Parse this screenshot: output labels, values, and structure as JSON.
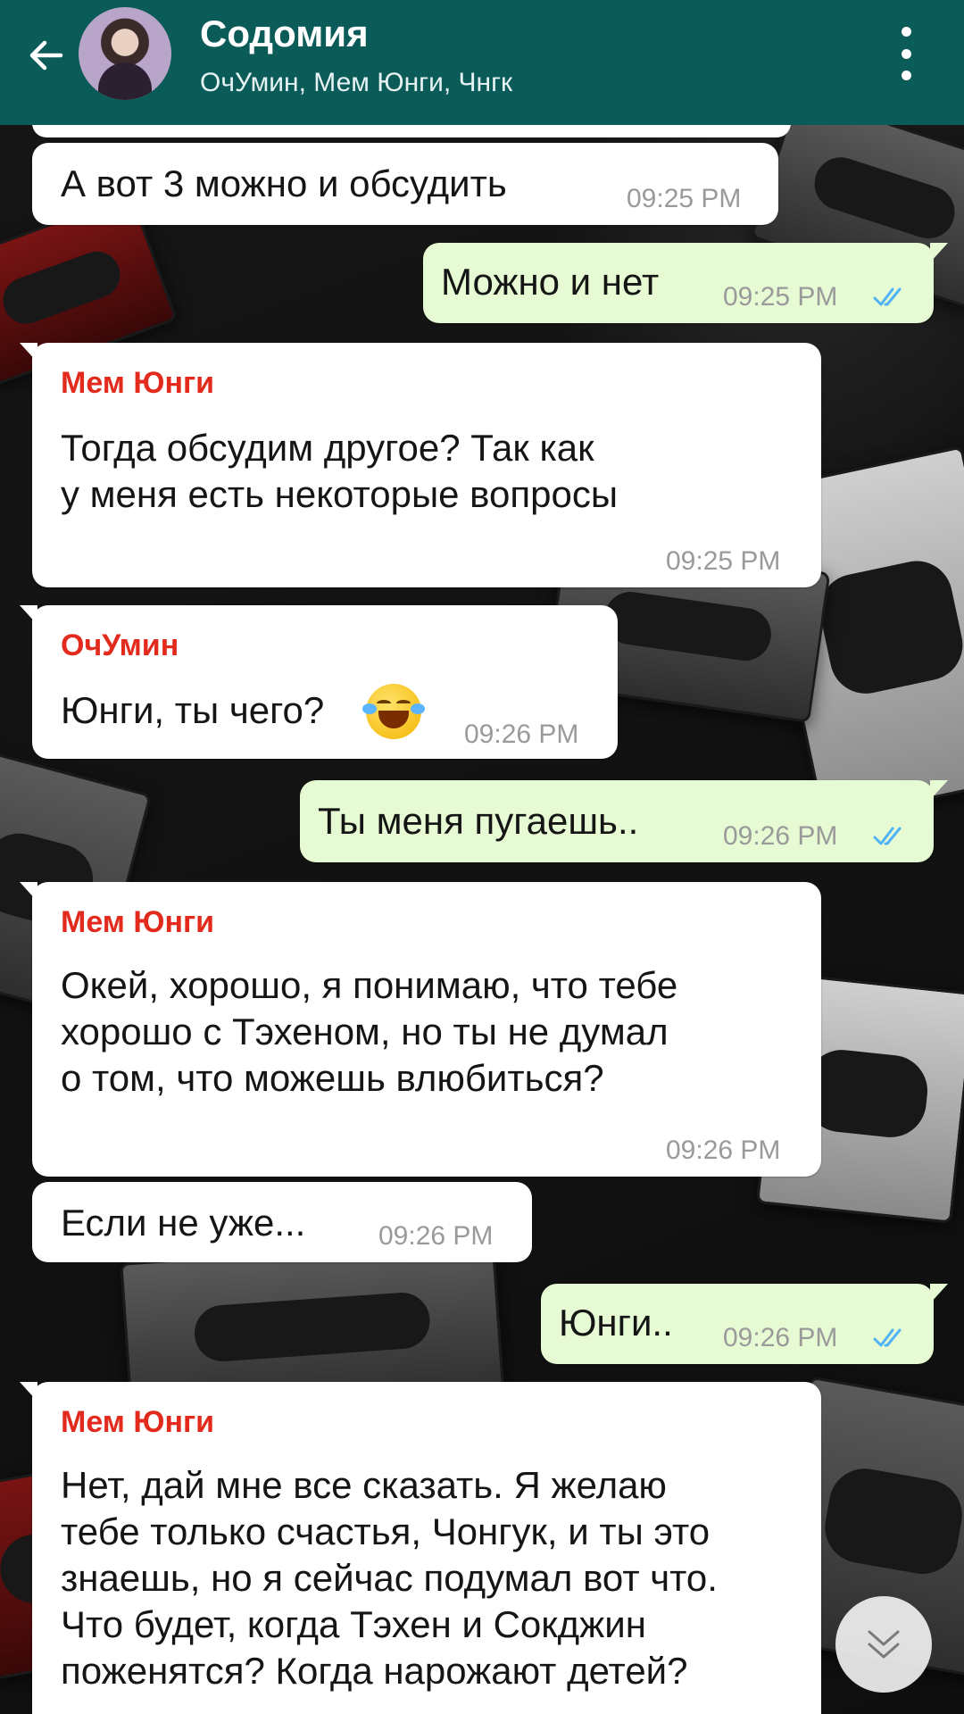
{
  "header": {
    "title": "Содомия",
    "subtitle": "ОчУмин, Мем Юнги, Чнгк",
    "back_icon": "arrow-left-icon",
    "menu_icon": "kebab-menu-icon",
    "background": "#0b5b59"
  },
  "messages": [
    {
      "direction": "in",
      "sender": "",
      "text": "А вот 3 можно и обсудить",
      "time": "09:25 PM"
    },
    {
      "direction": "out",
      "sender": "",
      "text": "Можно и нет",
      "time": "09:25 PM",
      "read": true
    },
    {
      "direction": "in",
      "sender": "Мем Юнги",
      "text": "Тогда обсудим другое? Так как\nу меня есть некоторые вопросы",
      "time": "09:25 PM"
    },
    {
      "direction": "in",
      "sender": "ОчУмин",
      "text": "Юнги, ты чего?",
      "emoji": "tears-of-joy-emoji",
      "time": "09:26 PM"
    },
    {
      "direction": "out",
      "sender": "",
      "text": "Ты меня пугаешь..",
      "time": "09:26 PM",
      "read": true
    },
    {
      "direction": "in",
      "sender": "Мем Юнги",
      "text": "Окей, хорошо, я понимаю, что тебе\nхорошо с Тэхеном, но ты не думал\nо том, что можешь влюбиться?",
      "time": "09:26 PM"
    },
    {
      "direction": "in",
      "sender": "",
      "text": "Если не уже...",
      "time": "09:26 PM"
    },
    {
      "direction": "out",
      "sender": "",
      "text": "Юнги..",
      "time": "09:26 PM",
      "read": true
    },
    {
      "direction": "in",
      "sender": "Мем Юнги",
      "text": "Нет, дай мне все сказать. Я желаю\nтебе только счастья, Чонгук, и ты это\nзнаешь, но я сейчас подумал вот что.\nЧто будет, когда Тэхен и Сокджин\nпоженятся? Когда нарожают детей?",
      "time": ""
    }
  ],
  "colors": {
    "incoming_bubble": "#ffffff",
    "outgoing_bubble": "#e6fbd4",
    "sender_name": "#e32b1d",
    "timestamp": "#9a9a9a",
    "read_ticks": "#4fb3f6"
  },
  "scroll_button_icon": "double-chevron-down-icon"
}
